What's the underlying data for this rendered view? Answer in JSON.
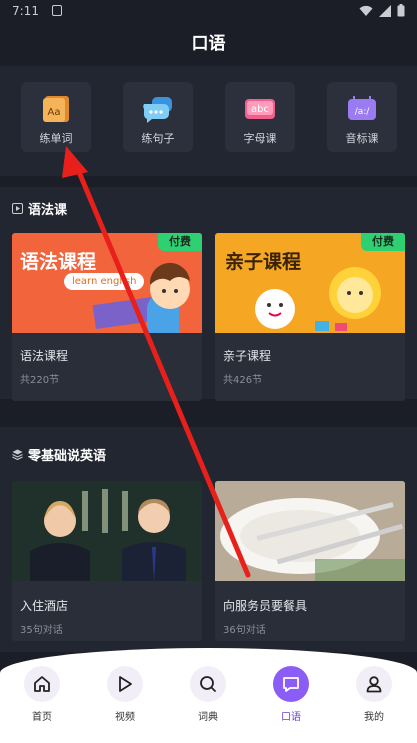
{
  "status_bar": {
    "time": "7:11"
  },
  "header": {
    "title": "口语"
  },
  "quick_actions": [
    {
      "label": "练单词",
      "icon": "word-book-icon",
      "color": "#f0a24a"
    },
    {
      "label": "练句子",
      "icon": "chat-bubbles-icon",
      "color": "#5bb8f5"
    },
    {
      "label": "字母课",
      "icon": "abc-icon",
      "color": "#f1608d"
    },
    {
      "label": "音标课",
      "icon": "phonetic-icon",
      "color": "#9b7bf2"
    }
  ],
  "grammar_section": {
    "title": "语法课",
    "cards": [
      {
        "name": "语法课程",
        "meta": "共220节",
        "badge": "付费",
        "thumb_text": "语法课程",
        "thumb_bubble": "learn english"
      },
      {
        "name": "亲子课程",
        "meta": "共426节",
        "badge": "付费",
        "thumb_text": "亲子课程"
      }
    ]
  },
  "speaking_section": {
    "title": "零基础说英语",
    "cards": [
      {
        "name": "入住酒店",
        "meta": "35句对话"
      },
      {
        "name": "向服务员要餐具",
        "meta": "36句对话"
      }
    ]
  },
  "tab_bar": [
    {
      "label": "首页",
      "icon": "home-icon"
    },
    {
      "label": "视频",
      "icon": "play-icon"
    },
    {
      "label": "词典",
      "icon": "search-icon"
    },
    {
      "label": "口语",
      "icon": "chat-icon",
      "active": true
    },
    {
      "label": "我的",
      "icon": "profile-icon"
    }
  ],
  "colors": {
    "accent": "#8b5cf6",
    "badge": "#2fd072",
    "annotation_arrow": "#e8201c"
  }
}
